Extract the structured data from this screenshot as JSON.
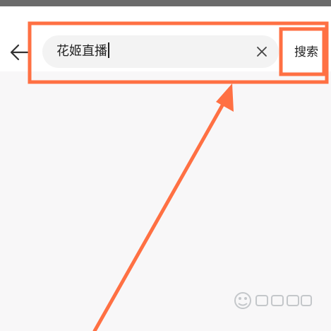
{
  "search": {
    "value": "花姬直播",
    "submit_label": "搜索"
  },
  "icons": {
    "back": "arrow-left-icon",
    "clear": "close-icon"
  },
  "colors": {
    "annotation": "#ff7043",
    "header_bg": "#ffffff",
    "content_bg": "#f8f7f8",
    "search_bg": "#f3f3f3"
  }
}
